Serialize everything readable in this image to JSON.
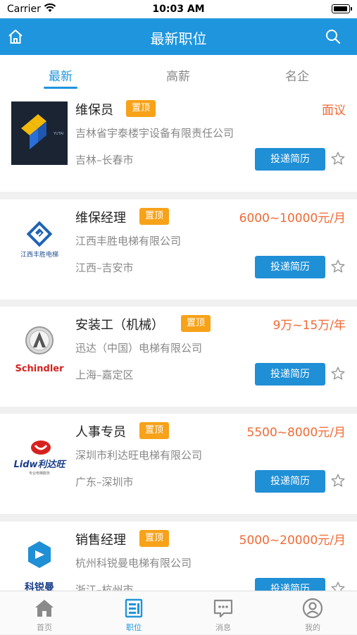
{
  "status_bar": {
    "carrier": "Carrier",
    "time": "10:03 AM"
  },
  "nav": {
    "title": "最新职位"
  },
  "tabs": [
    {
      "label": "最新",
      "active": true
    },
    {
      "label": "高薪",
      "active": false
    },
    {
      "label": "名企",
      "active": false
    }
  ],
  "jobs": [
    {
      "title": "维保员",
      "badge": "置顶",
      "salary": "面议",
      "company": "吉林省宇泰楼宇设备有限责任公司",
      "location": "吉林–长春市",
      "apply": "投递简历",
      "logo_text": "YUTAI"
    },
    {
      "title": "维保经理",
      "badge": "置顶",
      "salary": "6000~10000元/月",
      "company": "江西丰胜电梯有限公司",
      "location": "江西–吉安市",
      "apply": "投递简历",
      "logo_text": "江西丰胜电梯"
    },
    {
      "title": "安装工（机械）",
      "badge": "置顶",
      "salary": "9万~15万/年",
      "company": "迅达（中国）电梯有限公司",
      "location": "上海–嘉定区",
      "apply": "投递简历",
      "logo_text": "Schindler"
    },
    {
      "title": "人事专员",
      "badge": "置顶",
      "salary": "5500~8000元/月",
      "company": "深圳市利达旺电梯有限公司",
      "location": "广东–深圳市",
      "apply": "投递简历",
      "logo_text": "Lidw利达旺",
      "logo_sub": "专业电梯服务"
    },
    {
      "title": "销售经理",
      "badge": "置顶",
      "salary": "5000~20000元/月",
      "company": "杭州科锐曼电梯有限公司",
      "location": "浙江–杭州市",
      "apply": "投递简历",
      "logo_text": "科锐曼"
    }
  ],
  "tab_bar": [
    {
      "label": "首页",
      "icon": "home-icon",
      "active": false
    },
    {
      "label": "职位",
      "icon": "document-icon",
      "active": true
    },
    {
      "label": "消息",
      "icon": "message-icon",
      "active": false
    },
    {
      "label": "我的",
      "icon": "user-icon",
      "active": false
    }
  ],
  "colors": {
    "primary": "#1f95dd",
    "badge": "#f7a219",
    "salary": "#f06a35"
  }
}
